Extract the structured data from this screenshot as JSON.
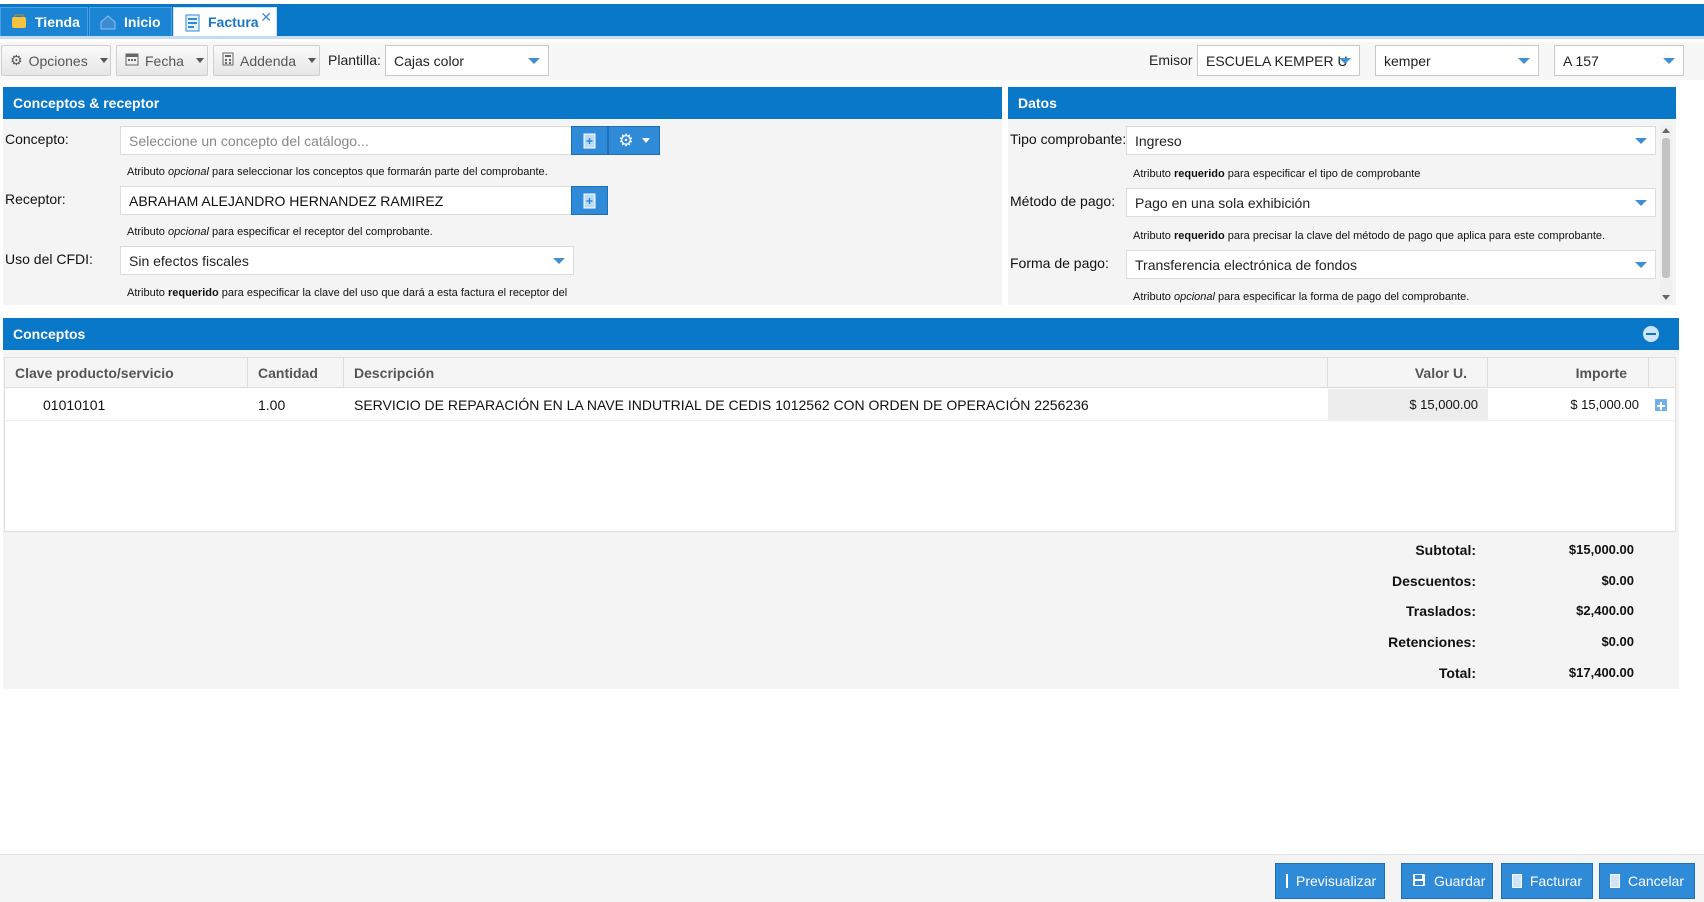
{
  "tabs": [
    {
      "label": "Tienda",
      "icon": "store-icon"
    },
    {
      "label": "Inicio",
      "icon": "home-icon"
    },
    {
      "label": "Factura",
      "icon": "invoice-icon",
      "active": true
    }
  ],
  "toolbar": {
    "opciones": "Opciones",
    "fecha": "Fecha",
    "addenda": "Addenda",
    "plantilla_label": "Plantilla:",
    "plantilla_value": "Cajas color",
    "emisor_label": "Emisor",
    "emisor_value": "ESCUELA KEMPER U",
    "emisor_user": "kemper",
    "serie": "A 157"
  },
  "conceptos_receptor": {
    "title": "Conceptos & receptor",
    "concepto_label": "Concepto:",
    "concepto_placeholder": "Seleccione un concepto del catálogo...",
    "concepto_hint_pre": "Atributo ",
    "concepto_hint_em": "opcional",
    "concepto_hint_post": " para seleccionar los conceptos que formarán parte del comprobante.",
    "receptor_label": "Receptor:",
    "receptor_value": "ABRAHAM ALEJANDRO HERNANDEZ RAMIREZ",
    "receptor_hint_pre": "Atributo ",
    "receptor_hint_em": "opcional",
    "receptor_hint_post": " para especificar el receptor del comprobante.",
    "uso_label": "Uso del CFDI:",
    "uso_value": "Sin efectos fiscales",
    "uso_hint_pre": "Atributo ",
    "uso_hint_b": "requerido",
    "uso_hint_post": " para especificar la clave del uso que dará a esta factura el receptor del"
  },
  "datos": {
    "title": "Datos",
    "tipo_label": "Tipo comprobante:",
    "tipo_value": "Ingreso",
    "tipo_hint_pre": "Atributo ",
    "tipo_hint_b": "requerido",
    "tipo_hint_post": " para especificar el tipo de comprobante",
    "metodo_label": "Método de pago:",
    "metodo_value": "Pago en una sola exhibición",
    "metodo_hint_pre": "Atributo ",
    "metodo_hint_b": "requerido",
    "metodo_hint_post": " para precisar la clave del método de pago que aplica para este comprobante.",
    "forma_label": "Forma de pago:",
    "forma_value": "Transferencia electrónica de fondos",
    "forma_hint_pre": "Atributo ",
    "forma_hint_em": "opcional",
    "forma_hint_post": " para especificar la forma de pago del comprobante."
  },
  "conceptos": {
    "title": "Conceptos",
    "columns": [
      "Clave producto/servicio",
      "Cantidad",
      "Descripción",
      "Valor U.",
      "Importe"
    ],
    "rows": [
      {
        "clave": "01010101",
        "cantidad": "1.00",
        "descripcion": "SERVICIO DE REPARACIÓN EN LA NAVE INDUTRIAL DE CEDIS 1012562 CON ORDEN DE OPERACIÓN 2256236",
        "valor": "$ 15,000.00",
        "importe": "$ 15,000.00"
      }
    ]
  },
  "totales": {
    "subtotal_label": "Subtotal:",
    "subtotal": "$15,000.00",
    "descuentos_label": "Descuentos:",
    "descuentos": "$0.00",
    "traslados_label": "Traslados:",
    "traslados": "$2,400.00",
    "retenciones_label": "Retenciones:",
    "retenciones": "$0.00",
    "total_label": "Total:",
    "total": "$17,400.00"
  },
  "footer": {
    "previsualizar": "Previsualizar",
    "guardar": "Guardar",
    "facturar": "Facturar",
    "cancelar": "Cancelar"
  },
  "colors": {
    "header_blue": "#0a78c9",
    "button_blue": "#2f8ad8"
  }
}
